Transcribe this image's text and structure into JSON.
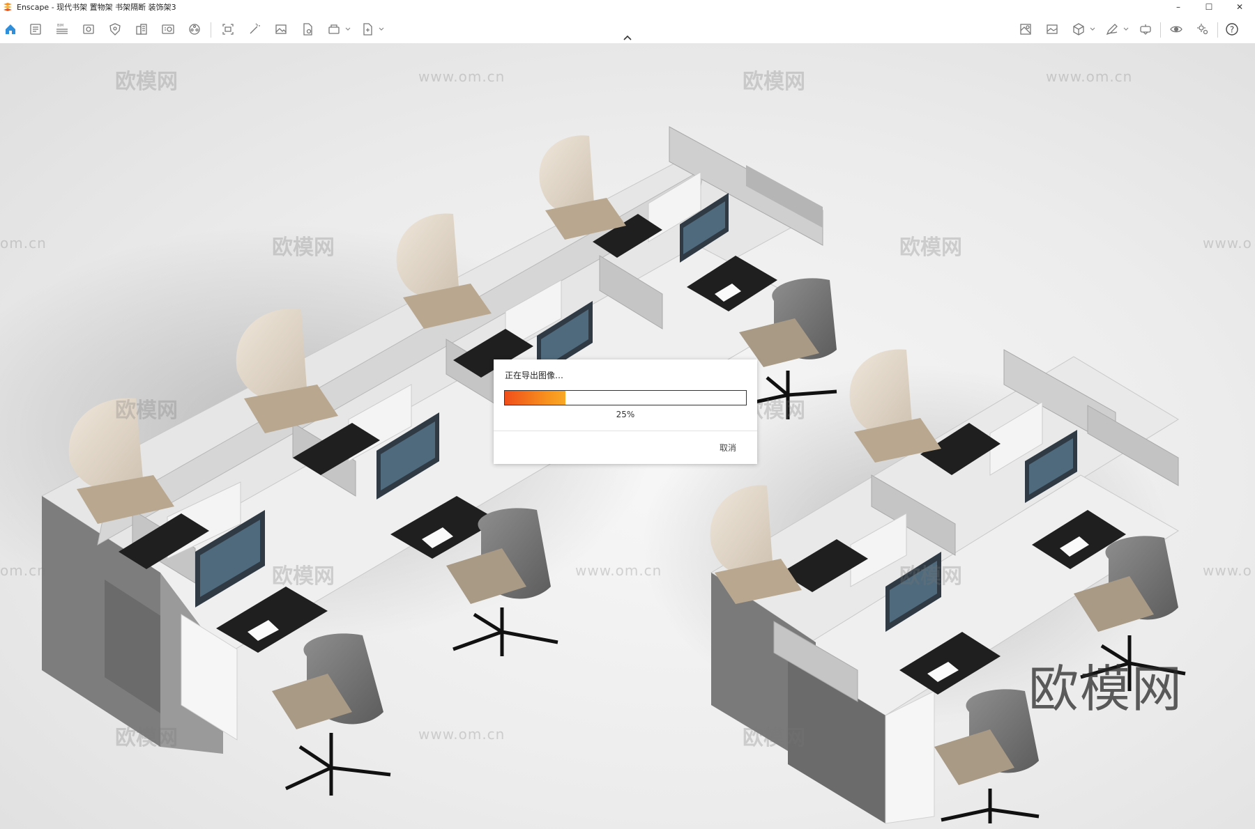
{
  "window": {
    "title": "Enscape - 现代书架 置物架 书架隔断 装饰架3",
    "minimize": "–",
    "maximize": "☐",
    "close": "✕"
  },
  "toolbar": {
    "left_tools": [
      "home-icon",
      "settings-document-icon",
      "bim-icon",
      "view-icon",
      "shield-icon",
      "building-icon",
      "asset-library-icon",
      "video-editor-icon",
      "screenshot-icon",
      "magic-icon",
      "image-icon",
      "file-info-icon",
      "batch-render-icon",
      "export-icon"
    ],
    "bim_badge": "BIM",
    "right_tools": [
      "map-icon",
      "image-compare-icon",
      "cube-icon",
      "pen-icon",
      "vr-headset-icon",
      "visibility-icon",
      "settings-icon",
      "help-icon"
    ],
    "help_label": "?"
  },
  "watermarks": {
    "brand_text": "欧模网",
    "url_text": "www.om.cn",
    "url_fragment": "om.cn",
    "url_fragment_right": "www.o"
  },
  "brand_mark": "欧模网",
  "dialog": {
    "title": "正在导出图像…",
    "progress_percent": 25,
    "progress_label": "25%",
    "cancel_label": "取消"
  },
  "colors": {
    "accent_orange": "#f7921e",
    "home_blue": "#2f8fdb"
  }
}
